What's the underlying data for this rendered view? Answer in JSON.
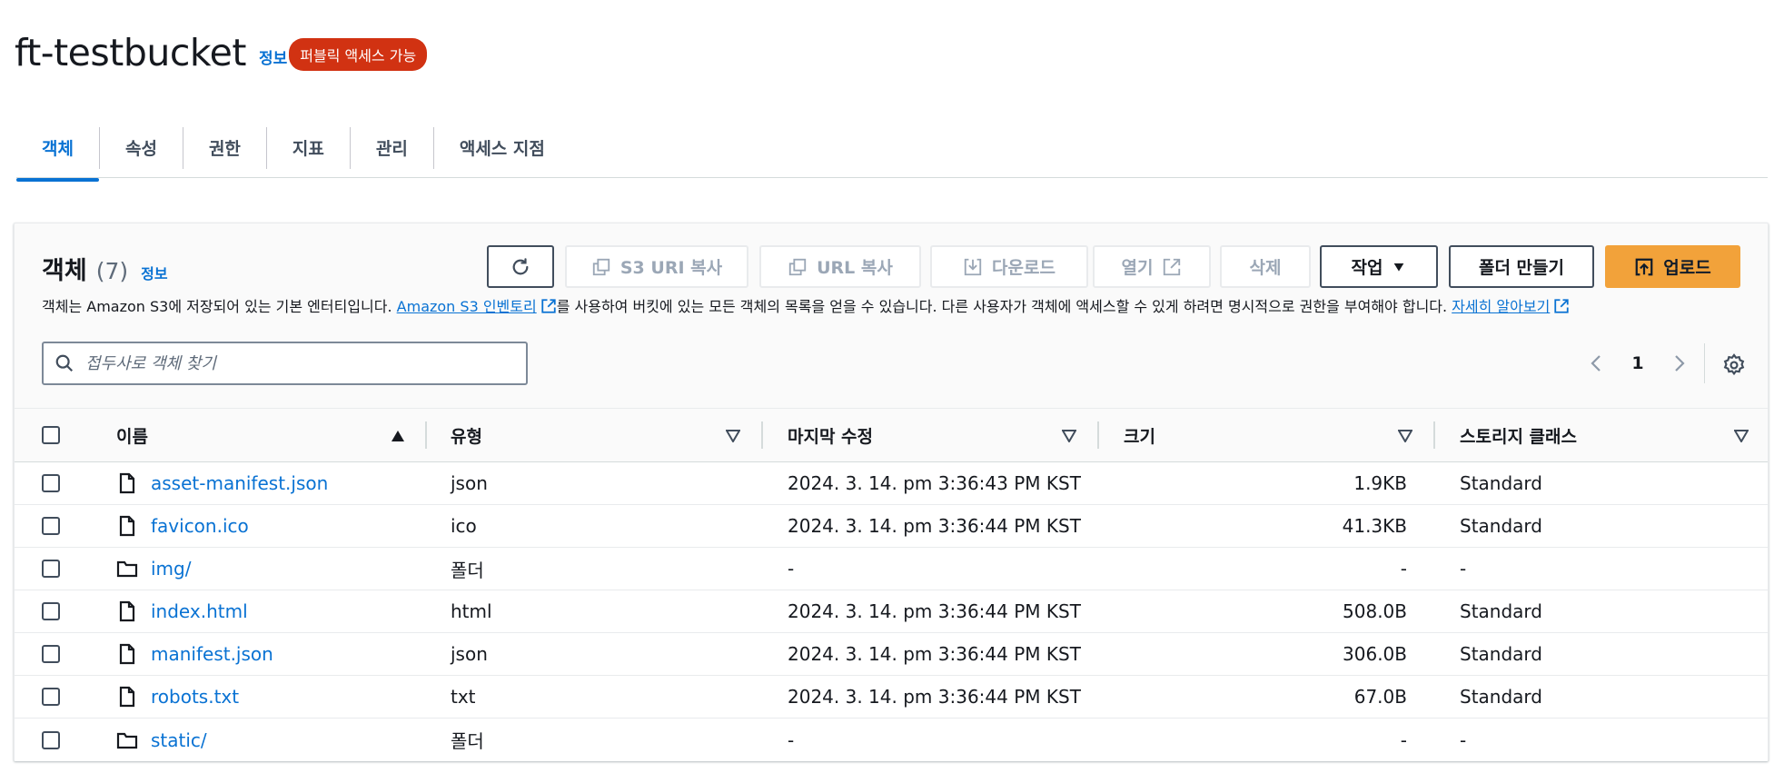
{
  "header": {
    "bucket_name": "ft-testbucket",
    "info_link": "정보",
    "public_badge": "퍼블릭 액세스 가능"
  },
  "tabs": [
    {
      "label": "객체",
      "active": true
    },
    {
      "label": "속성",
      "active": false
    },
    {
      "label": "권한",
      "active": false
    },
    {
      "label": "지표",
      "active": false
    },
    {
      "label": "관리",
      "active": false
    },
    {
      "label": "액세스 지점",
      "active": false
    }
  ],
  "objects_panel": {
    "title": "객체",
    "count": "(7)",
    "info_link": "정보",
    "description_before": "객체는 Amazon S3에 저장되어 있는 기본 엔터티입니다. ",
    "inventory_link": "Amazon S3 인벤토리",
    "description_middle": "를 사용하여 버킷에 있는 모든 객체의 목록을 얻을 수 있습니다. 다른 사용자가 객체에 액세스할 수 있게 하려면 명시적으로 권한을 부여해야 합니다. ",
    "learn_more_link": "자세히 알아보기"
  },
  "toolbar": {
    "refresh_icon": "refresh-icon",
    "copy_s3_uri": "S3 URI 복사",
    "copy_url": "URL 복사",
    "download": "다운로드",
    "open": "열기",
    "delete": "삭제",
    "actions": "작업",
    "create_folder": "폴더 만들기",
    "upload": "업로드"
  },
  "search": {
    "placeholder": "접두사로 객체 찾기",
    "value": ""
  },
  "pagination": {
    "current_page": "1"
  },
  "table": {
    "columns": [
      "이름",
      "유형",
      "마지막 수정",
      "크기",
      "스토리지 클래스"
    ],
    "rows": [
      {
        "icon": "file-icon",
        "name": "asset-manifest.json",
        "type": "json",
        "modified": "2024. 3. 14. pm 3:36:43 PM KST",
        "size": "1.9KB",
        "storage_class": "Standard"
      },
      {
        "icon": "file-icon",
        "name": "favicon.ico",
        "type": "ico",
        "modified": "2024. 3. 14. pm 3:36:44 PM KST",
        "size": "41.3KB",
        "storage_class": "Standard"
      },
      {
        "icon": "folder-icon",
        "name": "img/",
        "type": "폴더",
        "modified": "-",
        "size": "-",
        "storage_class": "-"
      },
      {
        "icon": "file-icon",
        "name": "index.html",
        "type": "html",
        "modified": "2024. 3. 14. pm 3:36:44 PM KST",
        "size": "508.0B",
        "storage_class": "Standard"
      },
      {
        "icon": "file-icon",
        "name": "manifest.json",
        "type": "json",
        "modified": "2024. 3. 14. pm 3:36:44 PM KST",
        "size": "306.0B",
        "storage_class": "Standard"
      },
      {
        "icon": "file-icon",
        "name": "robots.txt",
        "type": "txt",
        "modified": "2024. 3. 14. pm 3:36:44 PM KST",
        "size": "67.0B",
        "storage_class": "Standard"
      },
      {
        "icon": "folder-icon",
        "name": "static/",
        "type": "폴더",
        "modified": "-",
        "size": "-",
        "storage_class": "-"
      }
    ]
  },
  "colors": {
    "link": "#0972d3",
    "badge": "#d13212",
    "primary_button": "#f2a23a",
    "text": "#16191f",
    "disabled_text": "#9ba7b6"
  }
}
